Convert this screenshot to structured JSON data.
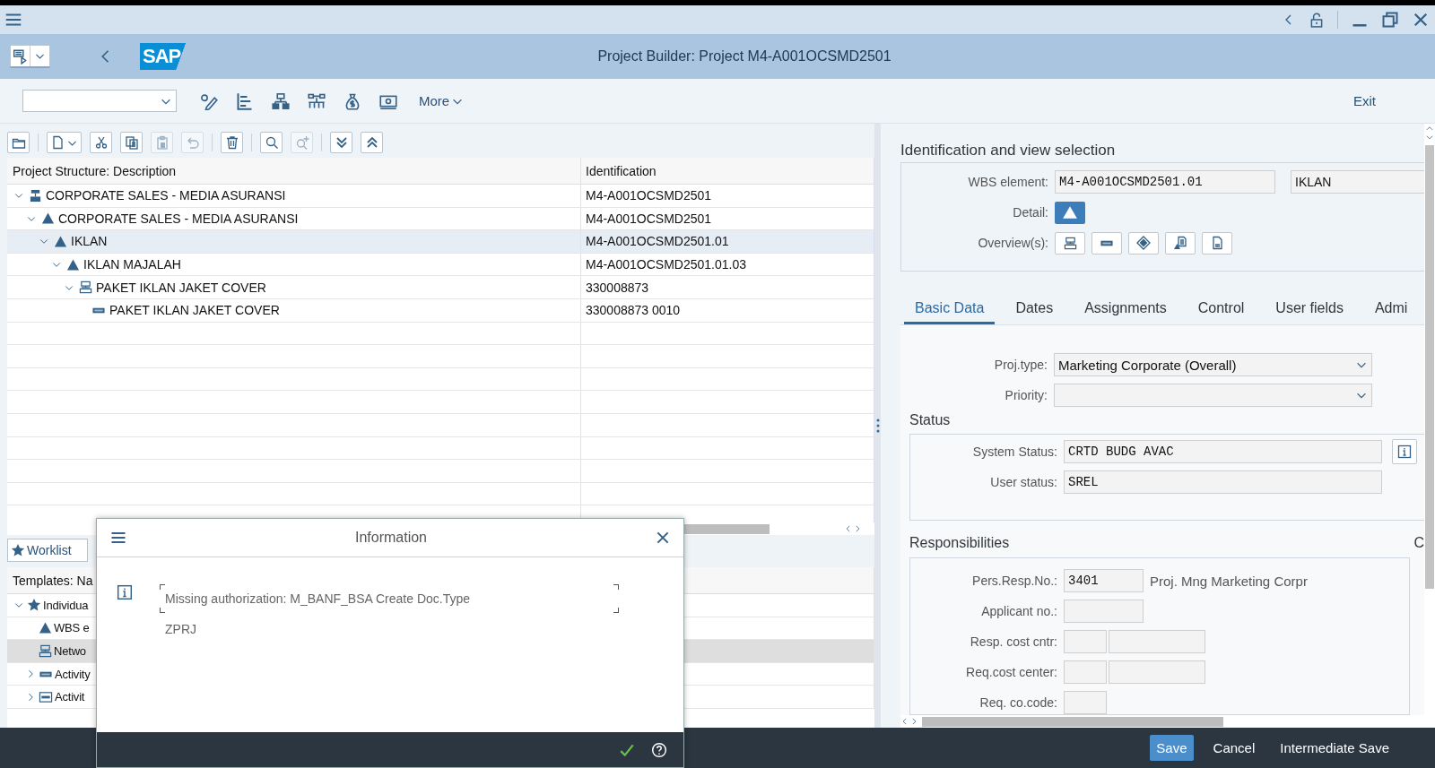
{
  "header": {
    "logo": "SAP",
    "title": "Project Builder: Project M4-A001OCSMD2501"
  },
  "toolbar": {
    "more": "More",
    "exit": "Exit"
  },
  "tree_toolbar": [
    [
      {
        "kind": "folder",
        "disabled": false
      }
    ],
    [
      {
        "kind": "new-doc",
        "disabled": false
      },
      {
        "kind": "scissors",
        "disabled": false
      },
      {
        "kind": "copy",
        "disabled": false
      },
      {
        "kind": "paste",
        "disabled": true
      },
      {
        "kind": "undo",
        "disabled": true
      }
    ],
    [
      {
        "kind": "trash",
        "disabled": false
      }
    ],
    [
      {
        "kind": "search",
        "disabled": false
      },
      {
        "kind": "search-plus",
        "disabled": true
      }
    ],
    [
      {
        "kind": "expand-all",
        "disabled": false
      },
      {
        "kind": "collapse-all",
        "disabled": false
      }
    ]
  ],
  "project_tree": {
    "columns": [
      "Project Structure: Description",
      "Identification"
    ],
    "rows": [
      {
        "description": "CORPORATE SALES - MEDIA ASURANSI",
        "identification": "M4-A001OCSMD2501",
        "kind": "project",
        "expanded": true,
        "selected": false,
        "children": [
          {
            "description": "CORPORATE SALES - MEDIA ASURANSI",
            "identification": "M4-A001OCSMD2501",
            "kind": "wbs",
            "expanded": true,
            "selected": false,
            "children": [
              {
                "description": "IKLAN",
                "identification": "M4-A001OCSMD2501.01",
                "kind": "wbs",
                "expanded": true,
                "selected": true,
                "children": [
                  {
                    "description": "IKLAN MAJALAH",
                    "identification": "M4-A001OCSMD2501.01.03",
                    "kind": "wbs",
                    "expanded": true,
                    "selected": false,
                    "children": [
                      {
                        "description": "PAKET IKLAN JAKET COVER",
                        "identification": "330008873",
                        "kind": "network",
                        "expanded": true,
                        "selected": false,
                        "children": [
                          {
                            "description": "PAKET IKLAN JAKET COVER",
                            "identification": "330008873 0010",
                            "kind": "activity",
                            "selected": false
                          }
                        ]
                      }
                    ]
                  }
                ]
              }
            ]
          }
        ]
      }
    ]
  },
  "worklist": {
    "label": "Worklist"
  },
  "templates": {
    "heading": "Templates: Na",
    "rows": [
      {
        "label": "Individua",
        "kind": "star",
        "expanded": true,
        "selected": false,
        "children": [
          {
            "label": "WBS e",
            "kind": "wbs",
            "selected": false
          },
          {
            "label": "Netwo",
            "kind": "network",
            "selected": true
          },
          {
            "label": "Activity",
            "kind": "activity",
            "expanded": false,
            "selected": false
          },
          {
            "label": "Activit",
            "kind": "activity-doc",
            "expanded": false,
            "selected": false
          }
        ]
      }
    ]
  },
  "identification": {
    "heading": "Identification and view selection",
    "wbs_label": "WBS element:",
    "wbs_value": "M4-A001OCSMD2501.01",
    "wbs_description": "IKLAN",
    "detail_label": "Detail:",
    "overview_label": "Overview(s):"
  },
  "tabs": [
    {
      "label": "Basic Data",
      "selected": true
    },
    {
      "label": "Dates",
      "selected": false
    },
    {
      "label": "Assignments",
      "selected": false
    },
    {
      "label": "Control",
      "selected": false
    },
    {
      "label": "User fields",
      "selected": false
    },
    {
      "label": "Admi",
      "selected": false
    }
  ],
  "basic_fields": [
    {
      "label": "Proj.type:",
      "value": "Marketing Corporate (Overall)",
      "kind": "dropdown"
    },
    {
      "label": "Priority:",
      "kind": "dropdown"
    }
  ],
  "status": {
    "heading": "Status",
    "fields": [
      {
        "label": "System Status:",
        "value": "CRTD BUDG AVAC"
      },
      {
        "label": "User status:",
        "value": "SREL"
      }
    ]
  },
  "responsibilities": {
    "heading": "Responsibilities",
    "side_heading": "C",
    "fields": [
      {
        "label": "Pers.Resp.No.:",
        "value": "3401",
        "text": "Proj. Mng Marketing Corpr",
        "kind": "short"
      },
      {
        "label": "Applicant no.:",
        "kind": "short"
      },
      {
        "label": "Resp. cost cntr:",
        "kind": "pair"
      },
      {
        "label": "Req.cost center:",
        "kind": "pair"
      },
      {
        "label": "Req. co.code:",
        "kind": "tiny"
      }
    ]
  },
  "footer": {
    "buttons": [
      {
        "label": "Save",
        "kind": "primary"
      },
      {
        "label": "Cancel",
        "kind": "plain"
      },
      {
        "label": "Intermediate Save",
        "kind": "plain"
      }
    ]
  },
  "dialog": {
    "title": "Information",
    "message": "Missing authorization: M_BANF_BSA Create Doc.Type",
    "message_continued": "ZPRJ"
  }
}
